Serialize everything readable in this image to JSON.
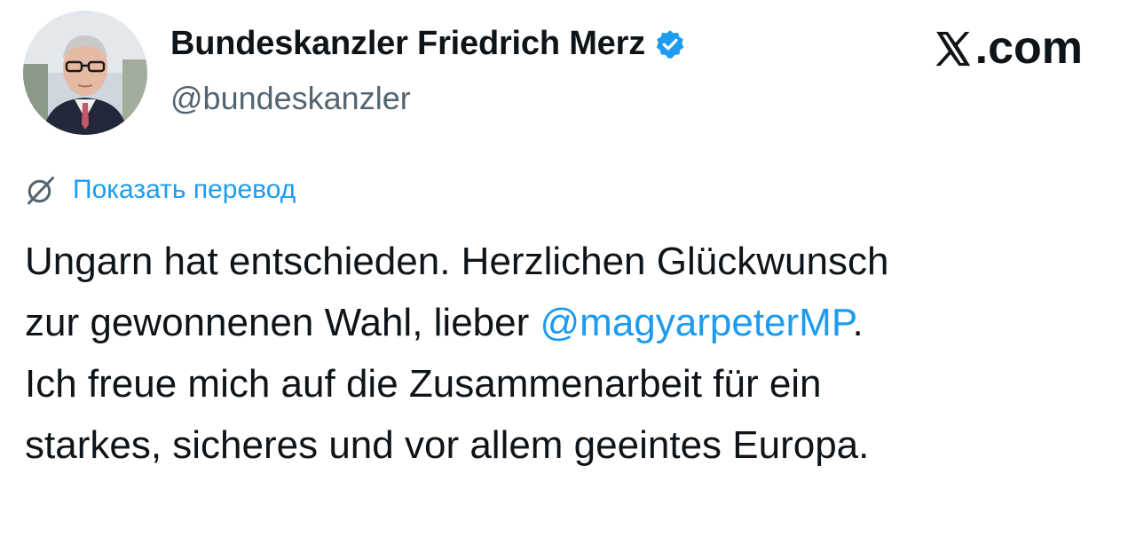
{
  "author": {
    "display_name": "Bundeskanzler Friedrich Merz",
    "handle": "@bundeskanzler",
    "verified_icon": "verified-badge-icon",
    "verified_color": "#1d9bf0"
  },
  "brand": {
    "label": ".com",
    "icon": "x-logo-icon"
  },
  "translate": {
    "icon": "translate-icon",
    "label": "Показать перевод"
  },
  "tweet": {
    "line1": "Ungarn hat entschieden. Herzlichen Glückwunsch",
    "line2_prefix": "zur gewonnenen Wahl, lieber ",
    "mention": "@magyarpeterMP",
    "line2_suffix": ".",
    "line3": "Ich freue mich auf die Zusammenarbeit für ein",
    "line4": "starkes, sicheres und vor allem geeintes Europa."
  },
  "colors": {
    "text": "#0f1419",
    "secondary_text": "#536471",
    "link": "#1d9bf0",
    "background": "#ffffff"
  }
}
